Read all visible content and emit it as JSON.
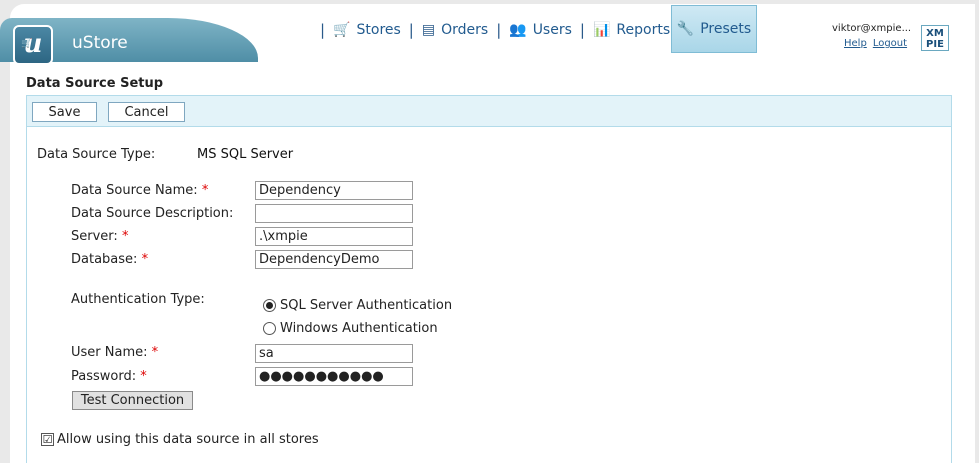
{
  "app": {
    "name": "uStore",
    "logo_letter": "u"
  },
  "nav": {
    "stores": "Stores",
    "orders": "Orders",
    "users": "Users",
    "reports": "Reports",
    "presets": "Presets",
    "separator": "|"
  },
  "user": {
    "email": "viktor@xmpie...",
    "help": "Help",
    "logout": "Logout"
  },
  "brand_badge": {
    "line1": "XM",
    "line2": "PIE"
  },
  "page": {
    "title": "Data Source Setup"
  },
  "toolbar": {
    "save_label": "Save",
    "cancel_label": "Cancel"
  },
  "form": {
    "type_label": "Data Source Type:",
    "type_value": "MS SQL Server",
    "name_label": "Data Source Name:",
    "name_value": "Dependency",
    "description_label": "Data Source Description:",
    "description_value": "",
    "server_label": "Server:",
    "server_value": ".\\xmpie",
    "database_label": "Database:",
    "database_value": "DependencyDemo",
    "auth_label": "Authentication Type:",
    "auth_sql": "SQL Server Authentication",
    "auth_windows": "Windows Authentication",
    "username_label": "User Name:",
    "username_value": "sa",
    "password_label": "Password:",
    "password_value": "●●●●●●●●●●●",
    "required_mark": "*",
    "test_button": "Test Connection",
    "allow_all_stores": "Allow using this data source in all stores",
    "allow_all_checked": "☑"
  }
}
